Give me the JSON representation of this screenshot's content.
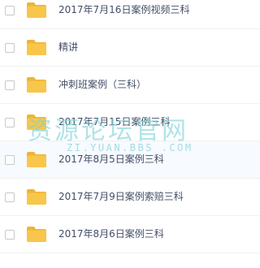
{
  "folders": [
    {
      "name": "2017年7月16日案例视频三科",
      "icon": "folder-icon"
    },
    {
      "name": "精讲",
      "icon": "folder-icon"
    },
    {
      "name": "冲刺班案例（三科）",
      "icon": "folder-icon"
    },
    {
      "name": "2017年7月15日案例三科",
      "icon": "folder-icon"
    },
    {
      "name": "2017年8月5日案例三科",
      "icon": "folder-icon"
    },
    {
      "name": "2017年7月9日案例索赔三科",
      "icon": "folder-icon"
    },
    {
      "name": "2017年8月6日案例三科",
      "icon": "folder-icon"
    }
  ],
  "watermark": {
    "main_text": "资源论坛官网",
    "url_text": "ZI.YUAN.BBS .COM"
  },
  "colors": {
    "folder": "#f8c64a",
    "folder_tab": "#eeb536",
    "text": "#424e67",
    "watermark": "#7ed2d8"
  }
}
